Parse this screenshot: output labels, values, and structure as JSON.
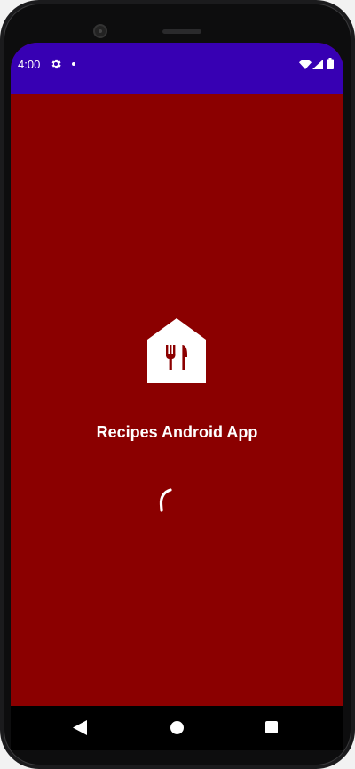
{
  "status_bar": {
    "time": "4:00",
    "icons": [
      "gear-icon",
      "notification-dot-icon",
      "wifi-icon",
      "signal-icon",
      "battery-icon"
    ],
    "background_color": "#3700b3"
  },
  "splash": {
    "logo_icon": "restaurant-house-icon",
    "title": "Recipes Android App",
    "loading_indicator": "circular-spinner",
    "background_color": "#8b0000"
  },
  "nav_bar": {
    "buttons": [
      "back-icon",
      "home-icon",
      "recents-icon"
    ]
  }
}
